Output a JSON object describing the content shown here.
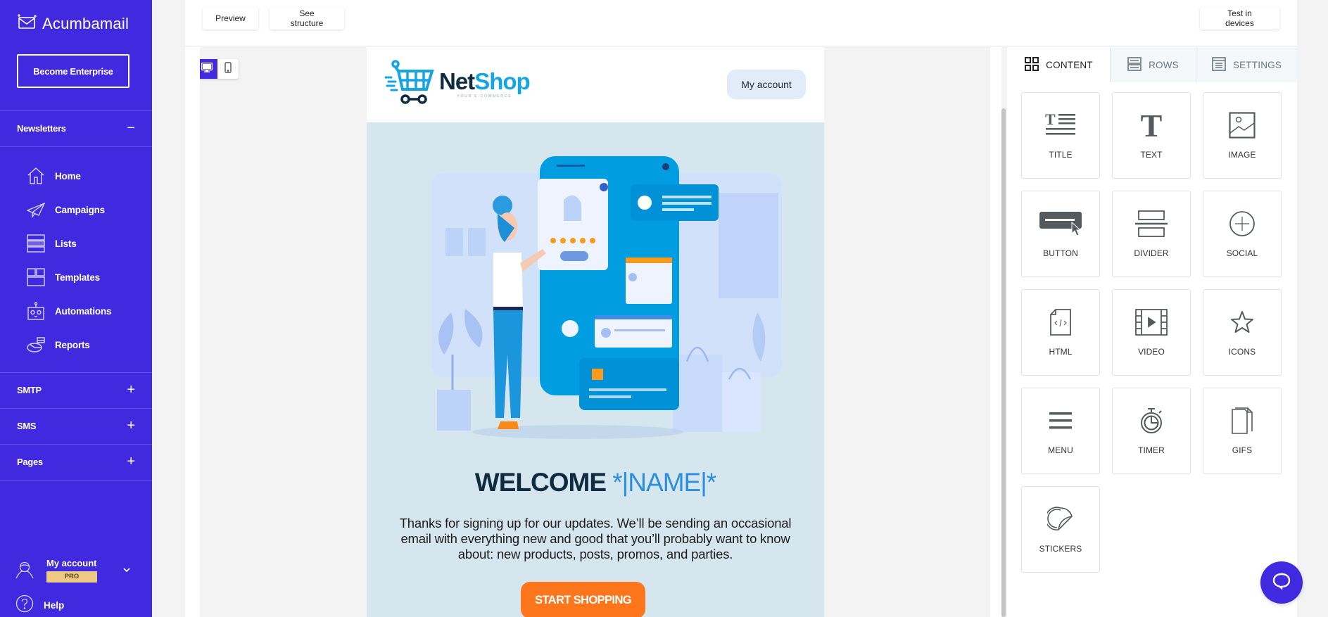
{
  "sidebar": {
    "brand": "Acumbamail",
    "enterprise_button": "Become Enterprise",
    "newsletters": {
      "label": "Newsletters",
      "toggle": "−"
    },
    "items": [
      {
        "label": "Home",
        "icon": "home-icon"
      },
      {
        "label": "Campaigns",
        "icon": "paper-plane-icon"
      },
      {
        "label": "Lists",
        "icon": "lists-icon"
      },
      {
        "label": "Templates",
        "icon": "templates-icon"
      },
      {
        "label": "Automations",
        "icon": "robot-icon"
      },
      {
        "label": "Reports",
        "icon": "pie-chart-icon"
      }
    ],
    "sections": [
      {
        "label": "SMTP",
        "toggle": "+"
      },
      {
        "label": "SMS",
        "toggle": "+"
      },
      {
        "label": "Pages",
        "toggle": "+"
      }
    ],
    "account": {
      "label": "My account",
      "badge": "PRO"
    },
    "help": "Help"
  },
  "toolbar": {
    "preview": "Preview",
    "see_structure": "See structure",
    "test_devices": "Test in devices"
  },
  "device_toggle": {
    "active": "desktop",
    "options": [
      "desktop",
      "mobile"
    ]
  },
  "email": {
    "logo_net": "Net",
    "logo_shop": "Shop",
    "logo_tagline": "YOUR E-COMMERCE",
    "header_button": "My account",
    "hero_alt": "Woman shopping on a giant smartphone illustration",
    "welcome": "WELCOME",
    "merge_tag": "*|NAME|*",
    "intro": "Thanks for signing up for our updates. We’ll be sending an occasional email with everything new and good that you’ll probably want to know about: new products, posts, promos, and parties.",
    "cta": "START SHOPPING"
  },
  "panel": {
    "tabs": [
      {
        "label": "CONTENT",
        "icon": "grid-icon",
        "active": true
      },
      {
        "label": "ROWS",
        "icon": "rows-icon",
        "active": false
      },
      {
        "label": "SETTINGS",
        "icon": "settings-doc-icon",
        "active": false
      }
    ],
    "blocks": [
      {
        "label": "TITLE",
        "icon": "title-icon"
      },
      {
        "label": "TEXT",
        "icon": "text-icon"
      },
      {
        "label": "IMAGE",
        "icon": "image-icon"
      },
      {
        "label": "BUTTON",
        "icon": "button-icon"
      },
      {
        "label": "DIVIDER",
        "icon": "divider-icon"
      },
      {
        "label": "SOCIAL",
        "icon": "social-icon"
      },
      {
        "label": "HTML",
        "icon": "html-icon"
      },
      {
        "label": "VIDEO",
        "icon": "video-icon"
      },
      {
        "label": "ICONS",
        "icon": "star-icon"
      },
      {
        "label": "MENU",
        "icon": "menu-icon"
      },
      {
        "label": "TIMER",
        "icon": "timer-icon"
      },
      {
        "label": "GIFS",
        "icon": "gifs-icon"
      },
      {
        "label": "STICKERS",
        "icon": "sticker-icon"
      }
    ]
  },
  "colors": {
    "brand": "#4029de",
    "cta": "#fd761c",
    "email_bg": "#d6e6ef",
    "pro_badge": "#eec984"
  }
}
